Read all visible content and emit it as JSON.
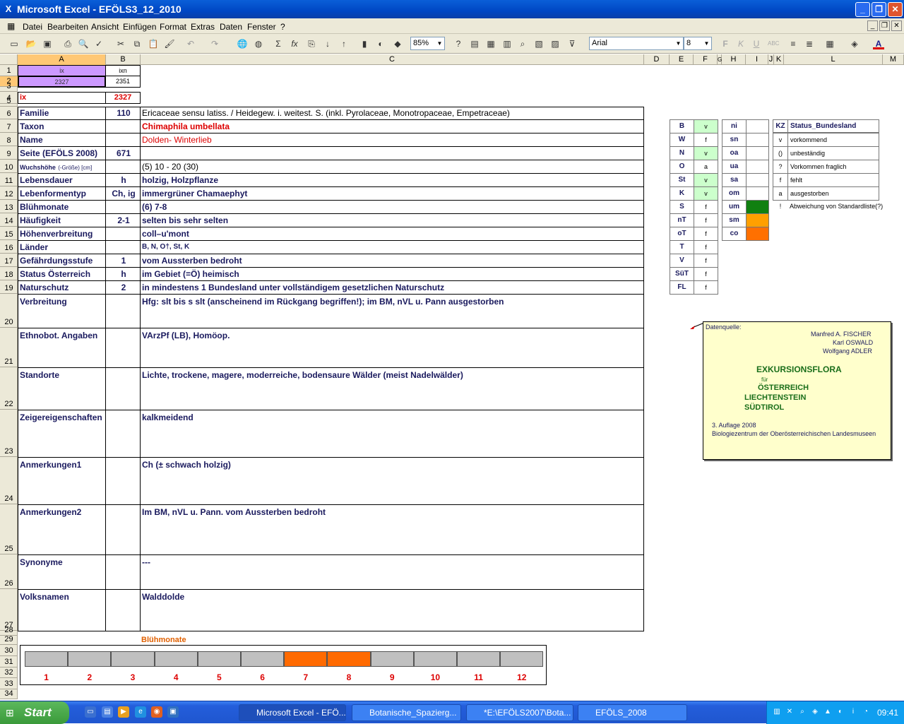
{
  "window": {
    "title": "Microsoft Excel - EFÖLS3_12_2010"
  },
  "menu": [
    "Datei",
    "Bearbeiten",
    "Ansicht",
    "Einfügen",
    "Format",
    "Extras",
    "Daten",
    "Fenster",
    "?"
  ],
  "toolbar": {
    "zoom": "85%",
    "font": "Arial",
    "size": "8"
  },
  "columns": [
    "A",
    "B",
    "C",
    "D",
    "E",
    "F",
    "G",
    "H",
    "I",
    "J",
    "K",
    "L",
    "M"
  ],
  "rows": [
    "1",
    "2",
    "3",
    "4",
    "5",
    "6",
    "7",
    "8",
    "9",
    "10",
    "11",
    "12",
    "13",
    "14",
    "15",
    "16",
    "17",
    "18",
    "19",
    "20",
    "21",
    "22",
    "23",
    "24",
    "25",
    "26",
    "27",
    "28",
    "29",
    "30",
    "31",
    "32",
    "33",
    "34"
  ],
  "top": {
    "a1": "ix",
    "b1": "ixn",
    "a2": "2327",
    "b2": "2351",
    "a4": "ix",
    "b4": "2327"
  },
  "fields": [
    {
      "label": "Familie",
      "code": "110",
      "value": "Ericaceae sensu latiss.  /  Heidegew. i. weitest. S. (inkl. Pyrolaceae, Monotropaceae, Empetraceae)"
    },
    {
      "label": "Taxon",
      "code": "",
      "value": "Chimaphila umbellata"
    },
    {
      "label": "Name",
      "code": "",
      "value": "Dolden- Winterlieb"
    },
    {
      "label": "Seite (EFÖLS 2008)",
      "code": "671",
      "value": ""
    },
    {
      "label": "Wuchshöhe",
      "label_suffix": "(-Größe) [cm]",
      "code": "",
      "value": " (5) 10 - 20 (30)"
    },
    {
      "label": "Lebensdauer",
      "code": "h",
      "value": "holzig, Holzpflanze"
    },
    {
      "label": "Lebenformentyp",
      "code": "Ch, ig",
      "value": "immergrüner Chamaephyt"
    },
    {
      "label": "Blühmonate",
      "code": "",
      "value": "(6) 7-8"
    },
    {
      "label": "Häufigkeit",
      "code": "2-1",
      "value": "selten bis sehr selten"
    },
    {
      "label": "Höhenverbreitung",
      "code": "",
      "value": "coll–u'mont"
    },
    {
      "label": "Länder",
      "code": "",
      "value": "B, N, O†, St, K"
    },
    {
      "label": "Gefährdungsstufe",
      "code": "1",
      "value": "vom Aussterben bedroht"
    },
    {
      "label": "Status Österreich",
      "code": "h",
      "value": "im Gebiet (=Ö) heimisch"
    },
    {
      "label": "Naturschutz",
      "code": "2",
      "value": "in mindestens 1 Bundesland unter vollständigem gesetzlichen Naturschutz"
    },
    {
      "label": "Verbreitung",
      "code": "",
      "value": "Hfg: slt bis s slt (anscheinend im Rückgang begriffen!); im BM, nVL u. Pann ausgestorben"
    },
    {
      "label": "Ethnobot. Angaben",
      "code": "",
      "value": "VArzPf (LB), Homöop."
    },
    {
      "label": "Standorte",
      "code": "",
      "value": "Lichte, trockene, magere, moderreiche, bodensaure Wälder (meist Nadelwälder)"
    },
    {
      "label": "Zeigereigenschaften",
      "code": "",
      "value": "kalkmeidend"
    },
    {
      "label": "Anmerkungen1",
      "code": "",
      "value": "Ch (± schwach holzig)"
    },
    {
      "label": "Anmerkungen2",
      "code": "",
      "value": "Im BM, nVL u. Pann. vom Aussterben bedroht"
    },
    {
      "label": "Synonyme",
      "code": "",
      "value": "---"
    },
    {
      "label": "Volksnamen",
      "code": "",
      "value": "Walddolde"
    }
  ],
  "laender": [
    {
      "k": "B",
      "v": "v"
    },
    {
      "k": "W",
      "v": "f"
    },
    {
      "k": "N",
      "v": "v"
    },
    {
      "k": "O",
      "v": "a"
    },
    {
      "k": "St",
      "v": "v"
    },
    {
      "k": "K",
      "v": "v"
    },
    {
      "k": "S",
      "v": "f"
    },
    {
      "k": "nT",
      "v": "f"
    },
    {
      "k": "oT",
      "v": "f"
    },
    {
      "k": "T",
      "v": "f"
    },
    {
      "k": "V",
      "v": "f"
    },
    {
      "k": "SüT",
      "v": "f"
    },
    {
      "k": "FL",
      "v": "f"
    }
  ],
  "hoehen": [
    {
      "k": "ni",
      "color": ""
    },
    {
      "k": "sn",
      "color": ""
    },
    {
      "k": "oa",
      "color": ""
    },
    {
      "k": "ua",
      "color": ""
    },
    {
      "k": "sa",
      "color": ""
    },
    {
      "k": "om",
      "color": ""
    },
    {
      "k": "um",
      "color": "#108010"
    },
    {
      "k": "sm",
      "color": "#ffa000"
    },
    {
      "k": "co",
      "color": "#ff7000"
    }
  ],
  "legend": {
    "header_k": "KZ",
    "header_v": "Status_Bundesland",
    "items": [
      {
        "k": "v",
        "v": "vorkommend"
      },
      {
        "k": "()",
        "v": "unbeständig"
      },
      {
        "k": "?",
        "v": "Vorkommen fraglich"
      },
      {
        "k": "f",
        "v": "fehlt"
      },
      {
        "k": "a",
        "v": "ausgestorben"
      },
      {
        "k": "!",
        "v": "Abweichung von Standardliste(?)"
      }
    ]
  },
  "datenquelle": {
    "label": "Datenquelle:",
    "authors": [
      "Manfred A. FISCHER",
      "Karl OSWALD",
      "Wolfgang ADLER"
    ],
    "title": "EXKURSIONSFLORA",
    "fuer": "für",
    "countries": [
      "ÖSTERREICH",
      "LIECHTENSTEIN",
      "SÜDTIROL"
    ],
    "edition": "3. Auflage 2008",
    "publisher": "Biologiezentrum der Oberösterreichischen Landesmuseen"
  },
  "bluehmonate_chart": {
    "title": "Blühmonate",
    "months": [
      "1",
      "2",
      "3",
      "4",
      "5",
      "6",
      "7",
      "8",
      "9",
      "10",
      "11",
      "12"
    ],
    "bloom": [
      false,
      false,
      false,
      false,
      false,
      false,
      true,
      true,
      false,
      false,
      false,
      false
    ],
    "on_color": "#ff6a00",
    "off_color": "#c0c0c0"
  },
  "taskbar": {
    "start": "Start",
    "tasks": [
      "Microsoft Excel - EFÖ...",
      "Botanische_Spazierg...",
      "*E:\\EFÖLS2007\\Bota...",
      "EFÖLS_2008"
    ],
    "clock": "09:41"
  }
}
